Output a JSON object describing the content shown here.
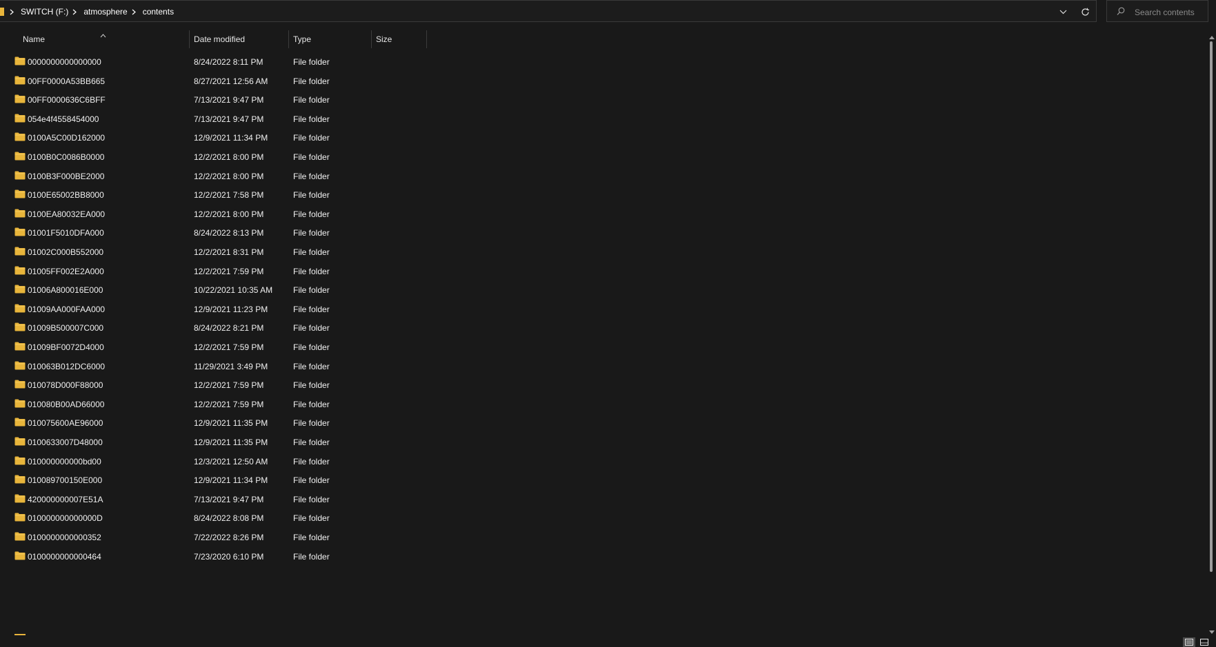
{
  "address": {
    "crumbs": [
      "SWITCH (F:)",
      "atmosphere",
      "contents"
    ]
  },
  "search": {
    "placeholder": "Search contents"
  },
  "columns": {
    "name": "Name",
    "date": "Date modified",
    "type": "Type",
    "size": "Size"
  },
  "files": [
    {
      "name": "0000000000000000",
      "date": "8/24/2022 8:11 PM",
      "type": "File folder"
    },
    {
      "name": "00FF0000A53BB665",
      "date": "8/27/2021 12:56 AM",
      "type": "File folder"
    },
    {
      "name": "00FF0000636C6BFF",
      "date": "7/13/2021 9:47 PM",
      "type": "File folder"
    },
    {
      "name": "054e4f4558454000",
      "date": "7/13/2021 9:47 PM",
      "type": "File folder"
    },
    {
      "name": "0100A5C00D162000",
      "date": "12/9/2021 11:34 PM",
      "type": "File folder"
    },
    {
      "name": "0100B0C0086B0000",
      "date": "12/2/2021 8:00 PM",
      "type": "File folder"
    },
    {
      "name": "0100B3F000BE2000",
      "date": "12/2/2021 8:00 PM",
      "type": "File folder"
    },
    {
      "name": "0100E65002BB8000",
      "date": "12/2/2021 7:58 PM",
      "type": "File folder"
    },
    {
      "name": "0100EA80032EA000",
      "date": "12/2/2021 8:00 PM",
      "type": "File folder"
    },
    {
      "name": "01001F5010DFA000",
      "date": "8/24/2022 8:13 PM",
      "type": "File folder"
    },
    {
      "name": "01002C000B552000",
      "date": "12/2/2021 8:31 PM",
      "type": "File folder"
    },
    {
      "name": "01005FF002E2A000",
      "date": "12/2/2021 7:59 PM",
      "type": "File folder"
    },
    {
      "name": "01006A800016E000",
      "date": "10/22/2021 10:35 AM",
      "type": "File folder"
    },
    {
      "name": "01009AA000FAA000",
      "date": "12/9/2021 11:23 PM",
      "type": "File folder"
    },
    {
      "name": "01009B500007C000",
      "date": "8/24/2022 8:21 PM",
      "type": "File folder"
    },
    {
      "name": "01009BF0072D4000",
      "date": "12/2/2021 7:59 PM",
      "type": "File folder"
    },
    {
      "name": "010063B012DC6000",
      "date": "11/29/2021 3:49 PM",
      "type": "File folder"
    },
    {
      "name": "010078D000F88000",
      "date": "12/2/2021 7:59 PM",
      "type": "File folder"
    },
    {
      "name": "010080B00AD66000",
      "date": "12/2/2021 7:59 PM",
      "type": "File folder"
    },
    {
      "name": "010075600AE96000",
      "date": "12/9/2021 11:35 PM",
      "type": "File folder"
    },
    {
      "name": "0100633007D48000",
      "date": "12/9/2021 11:35 PM",
      "type": "File folder"
    },
    {
      "name": "010000000000bd00",
      "date": "12/3/2021 12:50 AM",
      "type": "File folder"
    },
    {
      "name": "010089700150E000",
      "date": "12/9/2021 11:34 PM",
      "type": "File folder"
    },
    {
      "name": "420000000007E51A",
      "date": "7/13/2021 9:47 PM",
      "type": "File folder"
    },
    {
      "name": "010000000000000D",
      "date": "8/24/2022 8:08 PM",
      "type": "File folder"
    },
    {
      "name": "0100000000000352",
      "date": "7/22/2022 8:26 PM",
      "type": "File folder"
    },
    {
      "name": "0100000000000464",
      "date": "7/23/2020 6:10 PM",
      "type": "File folder"
    }
  ],
  "colors": {
    "folder": "#e8b53b",
    "background": "#191919",
    "text": "#ffffff"
  }
}
